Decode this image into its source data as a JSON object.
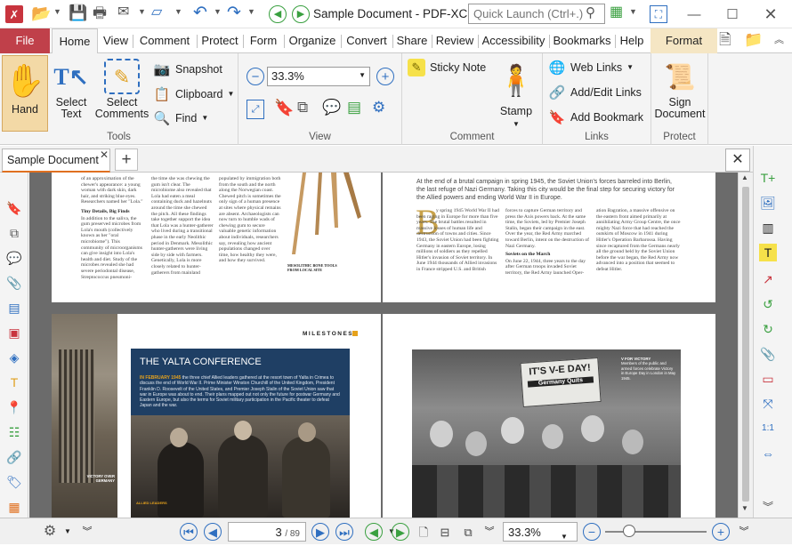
{
  "window": {
    "title": "Sample Document - PDF-XCha..."
  },
  "quick_launch": {
    "placeholder": "Quick Launch (Ctrl+.)"
  },
  "tabs": [
    "File",
    "Home",
    "View",
    "Comment",
    "Protect",
    "Form",
    "Organize",
    "Convert",
    "Share",
    "Review",
    "Accessibility",
    "Bookmarks",
    "Help",
    "Format"
  ],
  "ribbon": {
    "tools": {
      "group_label": "Tools",
      "hand": "Hand",
      "select_text_1": "Select",
      "select_text_2": "Text",
      "select_comments_1": "Select",
      "select_comments_2": "Comments",
      "snapshot": "Snapshot",
      "clipboard": "Clipboard",
      "find": "Find"
    },
    "view": {
      "group_label": "View",
      "zoom": "33.3%"
    },
    "comment": {
      "group_label": "Comment",
      "sticky_note": "Sticky Note",
      "stamp": "Stamp"
    },
    "links": {
      "group_label": "Links",
      "web_links": "Web Links",
      "add_edit_links": "Add/Edit Links",
      "add_bookmark": "Add Bookmark"
    },
    "protect": {
      "group_label": "Protect",
      "sign_1": "Sign",
      "sign_2": "Document"
    }
  },
  "document_tab": {
    "label": "Sample Document"
  },
  "pages": {
    "p1_col1": "of an approximation of the chewer's appearance: a young woman with dark skin, dark hair, and striking blue eyes. Researchers named her \"Lola.\"",
    "p1_head": "Tiny Details, Big Finds",
    "p1_col1b": "In addition to the saliva, the gum preserved microbes from Lola's mouth (collectively known as her \"oral microbiome\"). This community of microorganisms can give insight into Lola's health and diet. Study of the microbes revealed she had severe periodontal disease, Streptococcus pneumoni-",
    "p1_col2": "the time she was chewing the gum isn't clear. The microbiome also revealed that Lola had eaten a meal containing duck and hazelnuts around the time she chewed the pitch. All these findings take together support the idea that Lola was a hunter-gatherer who lived during a transitional phase in the early Neolithic period in Denmark. Mesolithic hunter-gatherers were living side by side with farmers. Genetically, Lola is more closely related to hunter-gatherers from mainland",
    "p1_col3": "populated by immigration both from the south and the north along the Norwegian coast. Chewed pitch is sometimes the only sign of a human presence at sites where physical remains are absent. Archaeologists can now turn to humble wads of chewing gum to secure valuable genetic information about individuals, researchers say, revealing how ancient populations changed over time, how healthy they were, and how they survived.",
    "p1_caption": "MESOLITHIC BONE TOOLS FROM LOCAL SITE",
    "p2_intro": "At the end of a brutal campaign in spring 1945, the Soviet Union's forces barreled into Berlin, the last refuge of Nazi Germany. Taking this city would be the final step for securing victory for the Allied powers and ending World War II in Europe.",
    "p2_col1": "y spring 1945 World War II had been raging in Europe for more than five years. The brutal battles resulted in massive losses of human life and destruction of towns and cities. Since 1943, the Soviet Union had been fighting Germany in eastern Europe, losing millions of soldiers as they repelled Hitler's invasion of Soviet territory. In June 1944 thousands of Allied invasions in France stripped U.S. and British",
    "p2_col2": "forces to capture German territory and press the Axis powers back. At the same time, the Soviets, led by Premier Joseph Stalin, began their campaign in the east. Over the year, the Red Army marched toward Berlin, intent on the destruction of Nazi Germany.",
    "p2_head": "Soviets on the March",
    "p2_col2b": "On June 22, 1944, three years to the day after German troops invaded Soviet territory, the Red Army launched Oper-",
    "p2_col3": "ation Bagration, a massive offensive on the eastern front aimed primarily at annihilating Army Group Centre, the once mighty Nazi force that had reached the outskirts of Moscow in 1941 during Hitler's Operation Barbarossa. Having since recaptured from the Germans nearly all the ground held by the Soviet Union before the war began, the Red Army now advanced into a position that seemed to defeat Hitler.",
    "p3_kicker": "MILESTONES",
    "p3_title": "THE YALTA CONFERENCE",
    "p3_lead": "IN FEBRUARY 1945",
    "p3_body": "the three chief Allied leaders gathered at the resort town of Yalta in Crimea to discuss the end of World War II. Prime Minister Winston Churchill of the United Kingdom, President Franklin D. Roosevelt of the United States, and Premier Joseph Stalin of the Soviet Union saw that war in Europe was about to end. Their plans mapped out not only the future for postwar Germany and Eastern Europe, but also the terms for Soviet military participation in the Pacific theater to defeat Japan and the war.",
    "p3_side_caption": "VICTORY OVER GERMANY",
    "p3_photo_caption": "ALLIED LEADERS",
    "p4_sign1": "IT'S V-E DAY!",
    "p4_sign2": "Germany Quits",
    "p4_caption_head": "V FOR VICTORY",
    "p4_caption": "Members of the public and armed forces celebrate Victory in Europe Day in London in May 1945."
  },
  "statusbar": {
    "page_current": "3",
    "page_total": "/ 89",
    "zoom": "33.3%"
  },
  "colors": {
    "file_tab": "#c0404a",
    "accent_blue": "#2f6fc0",
    "format_tab": "#f5e6c4",
    "doc_bg": "#6b6b6b"
  }
}
